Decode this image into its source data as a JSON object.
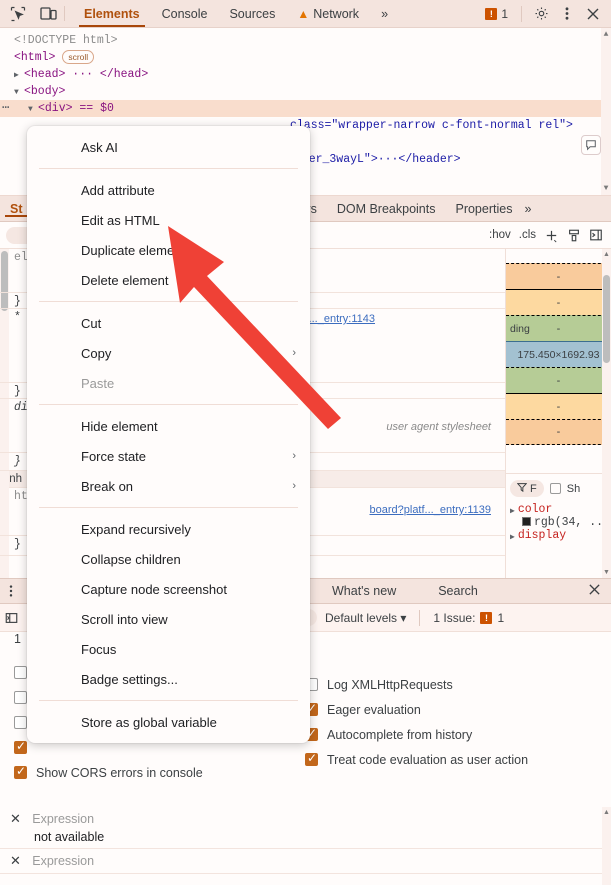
{
  "topbar": {
    "icons": [
      {
        "name": "inspect-element-icon"
      },
      {
        "name": "device-toolbar-icon"
      }
    ],
    "tabs": [
      {
        "label": "Elements",
        "active": true,
        "warn": false
      },
      {
        "label": "Console",
        "active": false,
        "warn": false
      },
      {
        "label": "Sources",
        "active": false,
        "warn": false
      },
      {
        "label": "Network",
        "active": false,
        "warn": true
      }
    ],
    "more_label": "»",
    "issue_count": "1",
    "issue_glyph": "!",
    "settings_icon": "gear-icon",
    "kebab_icon": "more-options-icon",
    "close_icon": "close-icon"
  },
  "dom": {
    "lines": [
      {
        "text": "<!DOCTYPE html>",
        "kind": "gray"
      },
      {
        "text": "<html>",
        "kind": "tag",
        "badge": "scroll"
      },
      {
        "text": "<head> ··· </head>",
        "kind": "tag",
        "triangle": "▶"
      },
      {
        "text": "<body>",
        "kind": "tag",
        "triangle": "▼"
      },
      {
        "text": "<div> == $0",
        "kind": "tag",
        "triangle": "▼",
        "selected": true
      }
    ],
    "partial_attr_line": "class=\"wrapper-narrow c-font-normal rel\">",
    "partial_header_line": "eader_3wayL\">···</header>",
    "ai_badge_icon": "ask-ai-icon"
  },
  "sidebar_tabs": {
    "first_partial": "St",
    "tabs": [
      "ners",
      "DOM Breakpoints",
      "Properties"
    ],
    "more_label": "»"
  },
  "styles_toolbar": {
    "filter_placeholder": "",
    "hov_label": ":hov",
    "cls_label": ".cls",
    "add_rule_icon": "add-style-rule-icon",
    "print_icon": "print-styles-icon",
    "sidebar_toggle_icon": "toggle-sidebar-icon"
  },
  "styles_rules": {
    "partial_labels": [
      "ele",
      "}",
      "* {",
      "}",
      "div",
      "}",
      "Inh",
      "htm",
      "}"
    ],
    "sources": [
      {
        "text": "board?platf..._entry:1143",
        "italic": false
      },
      {
        "text": "user agent stylesheet",
        "italic": true
      },
      {
        "text": "board?platf..._entry:1139",
        "italic": false
      }
    ]
  },
  "box_model": {
    "rows": [
      {
        "type": "margin",
        "value": "-"
      },
      {
        "type": "border",
        "value": "-"
      },
      {
        "type": "padding",
        "value": "-",
        "label": "ding"
      },
      {
        "type": "content",
        "value": "175.450×1692.93"
      },
      {
        "type": "padding",
        "value": "-"
      },
      {
        "type": "border",
        "value": "-"
      },
      {
        "type": "margin",
        "value": "-"
      }
    ],
    "colors": {
      "margin": "#f9cb9c",
      "border": "#fdd9a0",
      "padding": "#b6cc96",
      "content": "#a3c1d1"
    }
  },
  "computed": {
    "filter_label": "F",
    "show_all_label": "Sh",
    "filter_icon": "filter-icon",
    "properties": [
      {
        "name": "color",
        "value": "rgb(34, ...",
        "swatch": "#222222"
      },
      {
        "name": "display",
        "value": ""
      }
    ]
  },
  "drawer": {
    "kebab_icon": "drawer-more-icon",
    "tabs": [
      "What's new",
      "Search"
    ],
    "close_icon": "close-drawer-icon"
  },
  "console_toolbar": {
    "clear_icon": "clear-console-icon",
    "levels_label": "Default levels ▾",
    "issues_label": "1 Issue:",
    "issues_count": "1",
    "issue_glyph": "!",
    "top_label": "1"
  },
  "console_settings": {
    "left": [
      {
        "label": "",
        "checked": false
      },
      {
        "label": "",
        "checked": false
      },
      {
        "label": "",
        "checked": false
      },
      {
        "label": "",
        "checked": true
      },
      {
        "label": "Show CORS errors in console",
        "checked": true
      }
    ],
    "right": [
      {
        "label": "Log XMLHttpRequests",
        "checked": false
      },
      {
        "label": "Eager evaluation",
        "checked": true
      },
      {
        "label": "Autocomplete from history",
        "checked": true
      },
      {
        "label": "Treat code evaluation as user action",
        "checked": true
      }
    ]
  },
  "expressions": [
    {
      "close_icon": "remove-expression-icon",
      "name": "Expression",
      "value": "not available"
    },
    {
      "close_icon": "remove-expression-icon",
      "name": "Expression",
      "value": ""
    }
  ],
  "context_menu": {
    "groups": [
      [
        {
          "label": "Ask AI"
        }
      ],
      [
        {
          "label": "Add attribute"
        },
        {
          "label": "Edit as HTML"
        },
        {
          "label": "Duplicate element"
        },
        {
          "label": "Delete element"
        }
      ],
      [
        {
          "label": "Cut"
        },
        {
          "label": "Copy",
          "submenu": "›"
        },
        {
          "label": "Paste",
          "disabled": true
        }
      ],
      [
        {
          "label": "Hide element"
        },
        {
          "label": "Force state",
          "submenu": "›"
        },
        {
          "label": "Break on",
          "submenu": "›"
        }
      ],
      [
        {
          "label": "Expand recursively"
        },
        {
          "label": "Collapse children"
        },
        {
          "label": "Capture node screenshot"
        },
        {
          "label": "Scroll into view"
        },
        {
          "label": "Focus"
        },
        {
          "label": "Badge settings..."
        }
      ],
      [
        {
          "label": "Store as global variable"
        }
      ]
    ]
  },
  "annotation": {
    "arrow_color": "#ef4136",
    "arrow_target": "Edit as HTML"
  }
}
